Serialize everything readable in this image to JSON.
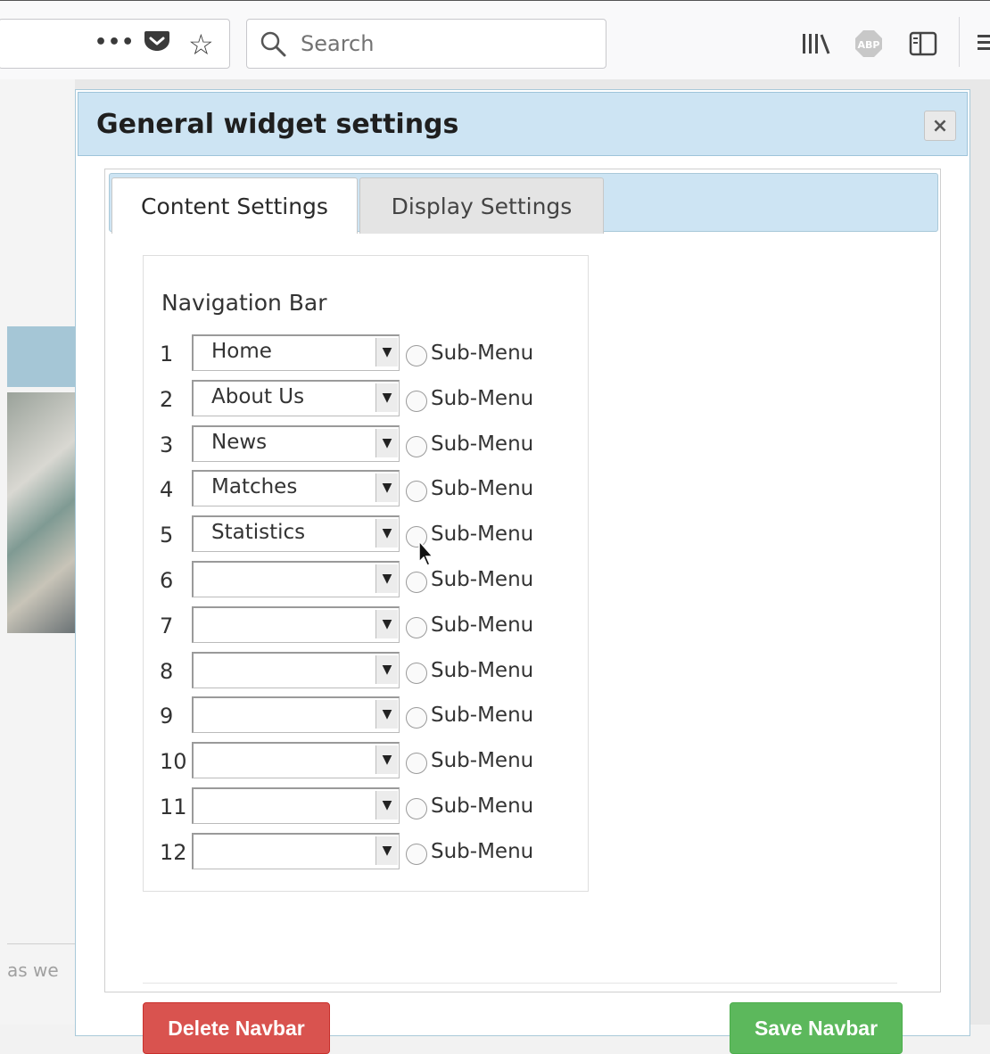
{
  "browser": {
    "search_placeholder": "Search",
    "overflow_glyph": "•••"
  },
  "background_page": {
    "footer_text": "as we"
  },
  "dialog": {
    "title": "General widget settings",
    "close_glyph": "×",
    "tabs": [
      {
        "label": "Content Settings",
        "active": true
      },
      {
        "label": "Display Settings",
        "active": false
      }
    ],
    "navigation": {
      "title": "Navigation Bar",
      "rows": [
        {
          "num": "1",
          "value": "Home",
          "radio_label": "Sub-Menu"
        },
        {
          "num": "2",
          "value": "About Us",
          "radio_label": "Sub-Menu"
        },
        {
          "num": "3",
          "value": "News",
          "radio_label": "Sub-Menu"
        },
        {
          "num": "4",
          "value": "Matches",
          "radio_label": "Sub-Menu"
        },
        {
          "num": "5",
          "value": "Statistics",
          "radio_label": "Sub-Menu"
        },
        {
          "num": "6",
          "value": "",
          "radio_label": "Sub-Menu"
        },
        {
          "num": "7",
          "value": "",
          "radio_label": "Sub-Menu"
        },
        {
          "num": "8",
          "value": "",
          "radio_label": "Sub-Menu"
        },
        {
          "num": "9",
          "value": "",
          "radio_label": "Sub-Menu"
        },
        {
          "num": "10",
          "value": "",
          "radio_label": "Sub-Menu"
        },
        {
          "num": "11",
          "value": "",
          "radio_label": "Sub-Menu"
        },
        {
          "num": "12",
          "value": "",
          "radio_label": "Sub-Menu"
        }
      ]
    },
    "buttons": {
      "delete_label": "Delete Navbar",
      "save_label": "Save Navbar"
    }
  },
  "colors": {
    "header_bg": "#cde4f3",
    "delete": "#d9534f",
    "save": "#5cb85c"
  }
}
